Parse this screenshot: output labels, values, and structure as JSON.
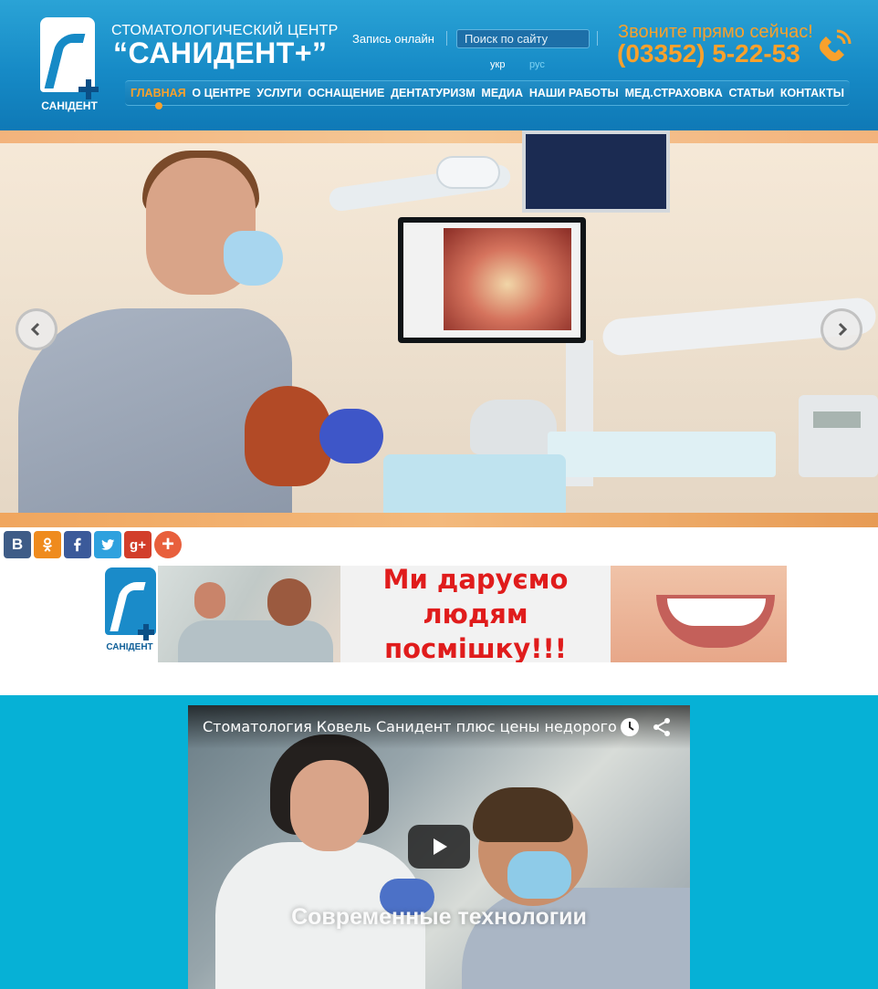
{
  "header": {
    "logo_text": "САНІДЕНТ",
    "brand_subtitle": "СТОМАТОЛОГИЧЕСКИЙ ЦЕНТР",
    "brand_title": "“САНИДЕНТ+”",
    "book_online": "Запись онлайн",
    "search_placeholder": "Поиск по сайту",
    "lang_ukr": "укр",
    "lang_rus": "рус",
    "call_text": "Звоните прямо сейчас!",
    "phone": "(03352) 5-22-53",
    "accent_color": "#f9a12c",
    "icons": [
      "phone-icon"
    ]
  },
  "nav": {
    "items": [
      {
        "label": "ГЛАВНАЯ",
        "active": true
      },
      {
        "label": "О ЦЕНТРЕ"
      },
      {
        "label": "УСЛУГИ"
      },
      {
        "label": "ОСНАЩЕНИЕ"
      },
      {
        "label": "ДЕНТАТУРИЗМ"
      },
      {
        "label": "МЕДИА"
      },
      {
        "label": "НАШИ РАБОТЫ"
      },
      {
        "label": "МЕД.СТРАХОВКА"
      },
      {
        "label": "СТАТЬИ"
      },
      {
        "label": "КОНТАКТЫ"
      }
    ]
  },
  "slider": {
    "icons": [
      "chevron-left-icon",
      "chevron-right-icon"
    ]
  },
  "social": {
    "vk": "В",
    "gplus": "g+",
    "more": "+",
    "icons": [
      "vk-icon",
      "odnoklassniki-icon",
      "facebook-icon",
      "twitter-icon",
      "google-plus-icon",
      "share-more-icon"
    ]
  },
  "banner": {
    "logo_text": "САНІДЕНТ",
    "slogan_line1": "Ми даруємо людям",
    "slogan_line2": "посмішку!!!"
  },
  "video": {
    "title": "Стоматология Ковель Санидент плюс цены недорого",
    "caption": "Современные технологии",
    "icons": [
      "clock-icon",
      "share-icon",
      "play-icon"
    ],
    "section_color": "#06b1d6"
  }
}
